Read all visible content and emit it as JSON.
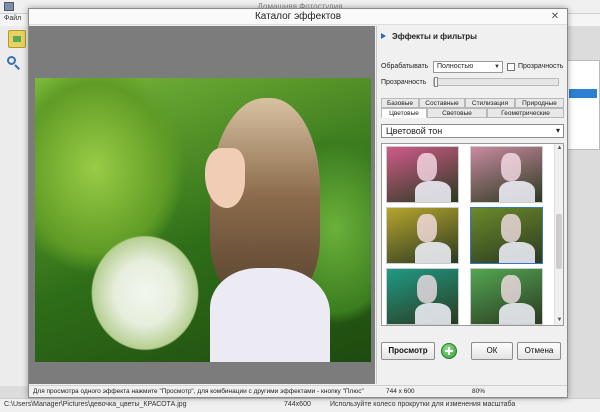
{
  "main_window": {
    "title": "Домашняя Фотостудия",
    "menu_file": "Файл",
    "status": {
      "path": "C:\\Users\\Manager\\Pictures\\девочка_цветы_КРАСОТА.jpg",
      "size": "744x600",
      "hint": "Используйте колесо прокрутки для изменения масштаба"
    }
  },
  "dialog": {
    "title": "Каталог эффектов",
    "close_label": "✕",
    "panel": {
      "header": "Эффекты и фильтры",
      "process_label": "Обрабатывать",
      "process_value": "Полностью",
      "transparency_check_label": "Прозрачность",
      "transparency_slider_label": "Прозрачность",
      "transparency_value": 0
    },
    "tabs_row1": [
      "Базовые",
      "Составные",
      "Стилизация",
      "Природные"
    ],
    "tabs_row2": [
      "Цветовые",
      "Световые",
      "Геометрические"
    ],
    "active_tab": "Цветовые",
    "effect_selected": "Цветовой тон",
    "buttons": {
      "preview": "Просмотр",
      "ok": "ОК",
      "cancel": "Отмена"
    },
    "status": {
      "hint": "Для просмотра одного эффекта нажмите \"Просмотр\", для комбинации с другими эффектами - кнопку \"Плюс\"",
      "size": "744 x 600",
      "zoom": "80%"
    }
  },
  "icons": {
    "open": "folder-open-icon",
    "zoom": "zoom-icon",
    "plus": "plus-icon"
  },
  "thumb_tints": [
    "#d05a8a",
    "#c98aa0",
    "#b6a42e",
    "#6b8a2a",
    "#1f9a86",
    "#53a653"
  ]
}
